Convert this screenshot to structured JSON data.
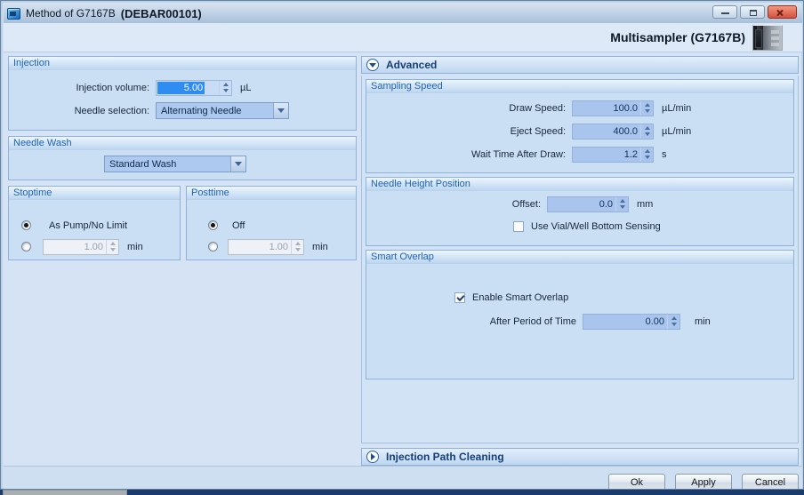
{
  "window": {
    "title": "Method of G7167B",
    "title_id": "(DEBAR00101)"
  },
  "header": {
    "device_title": "Multisampler (G7167B)"
  },
  "injection": {
    "section_title": "Injection",
    "volume_label": "Injection volume:",
    "volume_value": "5.00",
    "volume_unit": "µL",
    "needle_label": "Needle selection:",
    "needle_value": "Alternating Needle"
  },
  "needle_wash": {
    "section_title": "Needle Wash",
    "value": "Standard Wash"
  },
  "stoptime": {
    "section_title": "Stoptime",
    "option1": "As Pump/No Limit",
    "option1_selected": true,
    "time_value": "1.00",
    "unit": "min"
  },
  "posttime": {
    "section_title": "Posttime",
    "option1": "Off",
    "option1_selected": true,
    "time_value": "1.00",
    "unit": "min"
  },
  "advanced": {
    "title": "Advanced",
    "sampling_speed": {
      "section_title": "Sampling Speed",
      "rows": [
        {
          "label": "Draw Speed:",
          "value": "100.0",
          "unit": "µL/min"
        },
        {
          "label": "Eject Speed:",
          "value": "400.0",
          "unit": "µL/min"
        },
        {
          "label": "Wait Time After Draw:",
          "value": "1.2",
          "unit": "s"
        }
      ]
    },
    "needle_height": {
      "section_title": "Needle Height Position",
      "offset_label": "Offset:",
      "offset_value": "0.0",
      "offset_unit": "mm",
      "checkbox_label": "Use Vial/Well Bottom Sensing",
      "checkbox_checked": false
    },
    "smart_overlap": {
      "section_title": "Smart Overlap",
      "enable_label": "Enable Smart Overlap",
      "enable_checked": true,
      "period_label": "After Period of Time",
      "period_value": "0.00",
      "period_unit": "min"
    }
  },
  "injection_path_cleaning": {
    "title": "Injection Path Cleaning"
  },
  "footer": {
    "ok": "Ok",
    "apply": "Apply",
    "cancel": "Cancel"
  },
  "colors": {
    "selection_highlight": "#2f8df2",
    "close_button": "#d4523f",
    "section_header_text": "#1e63b5"
  }
}
